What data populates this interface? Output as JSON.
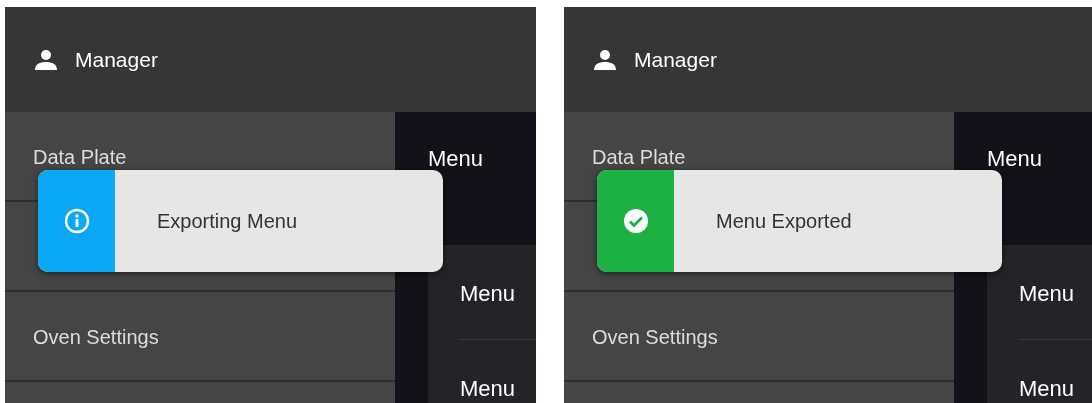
{
  "panels": [
    {
      "header": {
        "user": "Manager"
      },
      "sidebar": {
        "items": [
          {
            "label": "Data Plate"
          },
          {
            "label": "Oven Settings"
          }
        ]
      },
      "content": {
        "title": "Menu",
        "items": [
          "Menu",
          "Menu"
        ]
      },
      "toast": {
        "kind": "info",
        "message": "Exporting Menu"
      }
    },
    {
      "header": {
        "user": "Manager"
      },
      "sidebar": {
        "items": [
          {
            "label": "Data Plate"
          },
          {
            "label": "Oven Settings"
          }
        ]
      },
      "content": {
        "title": "Menu",
        "items": [
          "Menu",
          "Menu"
        ]
      },
      "toast": {
        "kind": "success",
        "message": "Menu Exported"
      }
    }
  ]
}
